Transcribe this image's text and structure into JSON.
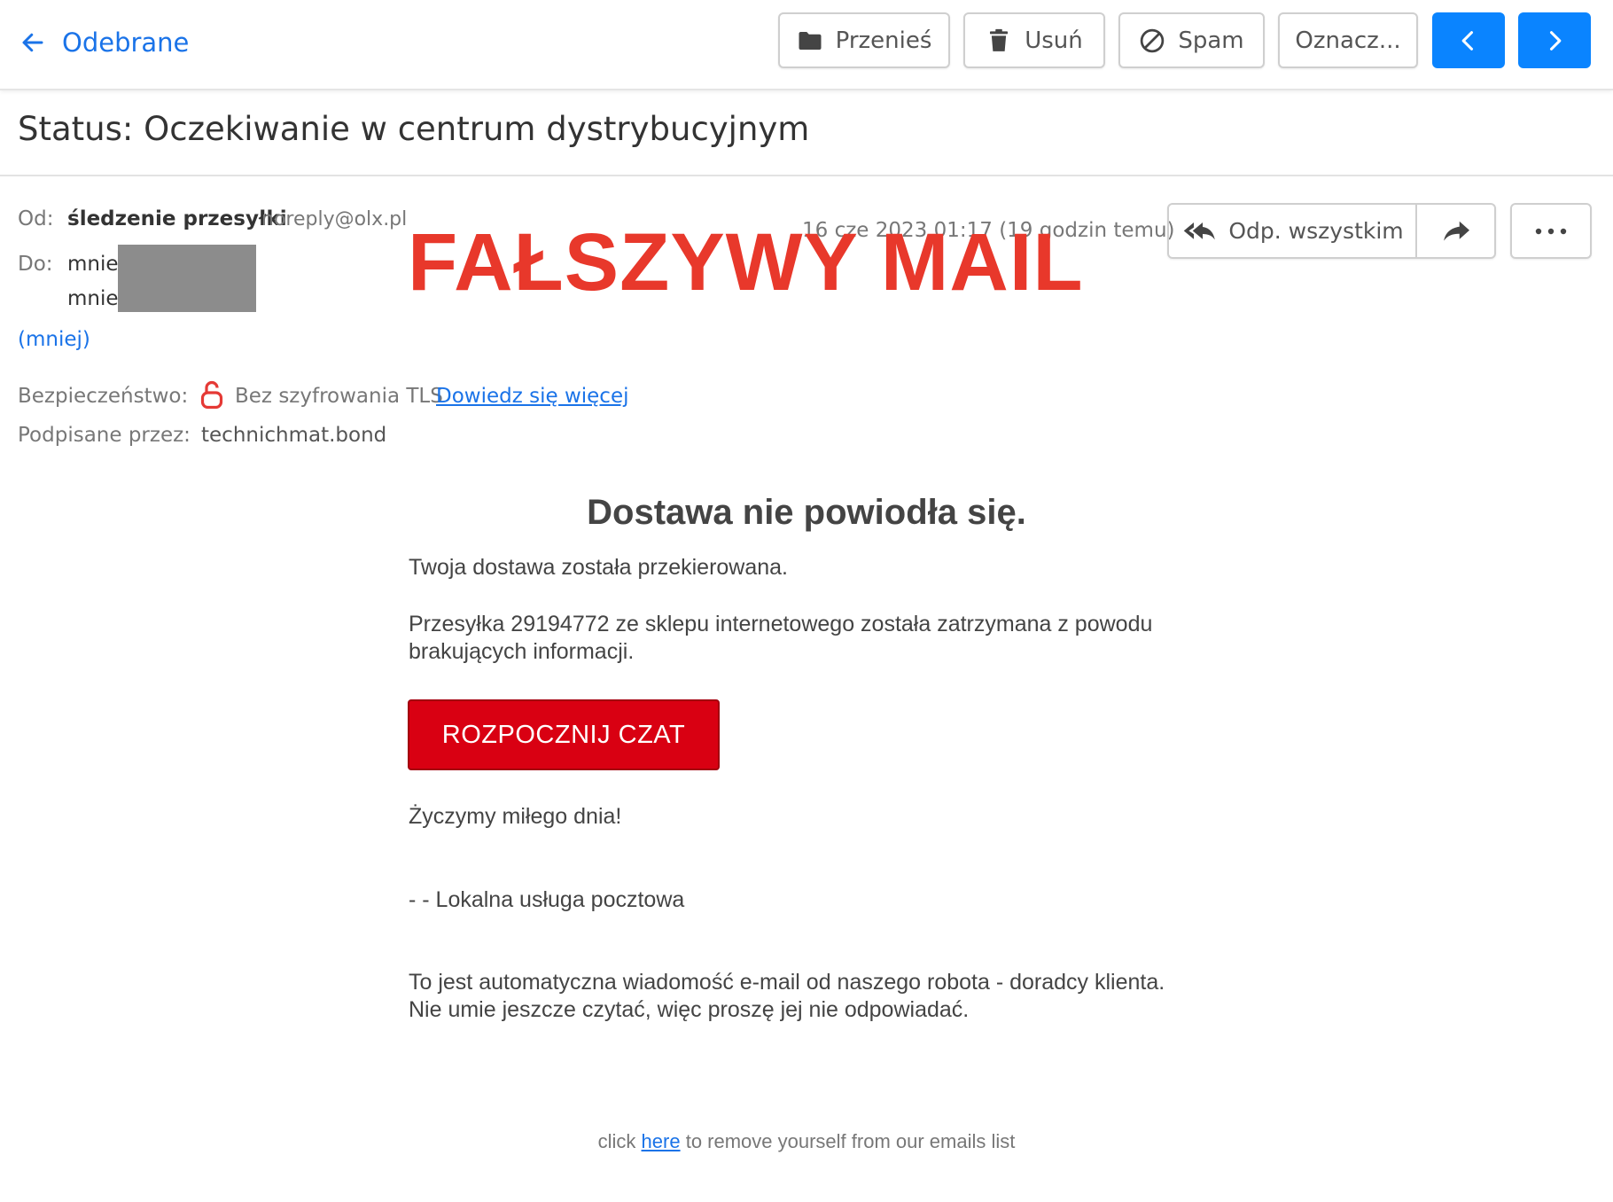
{
  "toolbar": {
    "back_label": "Odebrane",
    "move_label": "Przenieś",
    "delete_label": "Usuń",
    "spam_label": "Spam",
    "mark_label": "Oznacz...",
    "accent_color": "#0a84ff"
  },
  "message": {
    "subject": "Status: Oczekiwanie w centrum dystrybucyjnym",
    "from_label": "Od:",
    "from_name": "śledzenie przesyłki",
    "from_email": "noreply@olx.pl",
    "to_label": "Do:",
    "recipients": [
      "mnie",
      "mnie"
    ],
    "less_link": "(mniej)",
    "date": "16 cze 2023 01:17 (19 godzin temu)",
    "reply_all_label": "Odp. wszystkim",
    "security_label": "Bezpieczeństwo:",
    "security_value": "Bez szyfrowania TLS",
    "learn_more": "Dowiedz się więcej",
    "signed_label": "Podpisane przez:",
    "signed_value": "technichmat.bond"
  },
  "overlay": {
    "warning_text": "FAŁSZYWY MAIL",
    "color": "#e8382b"
  },
  "body": {
    "heading": "Dostawa nie powiodła się.",
    "line1": "Twoja dostawa została przekierowana.",
    "line2a": "Przesyłka 29194772 ze sklepu internetowego została zatrzymana z powodu",
    "line2b": "brakujących informacji.",
    "cta_label": "ROZPOCZNIJ CZAT",
    "cta_color": "#d90012",
    "greeting": "Życzymy miłego dnia!",
    "signature": "-  - Lokalna usługa pocztowa",
    "auto_note_1": "To jest automatyczna wiadomość e-mail od naszego robota - doradcy klienta.",
    "auto_note_2": "Nie umie jeszcze czytać, więc proszę jej nie odpowiadać.",
    "footer_prefix": "click",
    "footer_link": "here",
    "footer_suffix": "to remove yourself from our emails list"
  }
}
